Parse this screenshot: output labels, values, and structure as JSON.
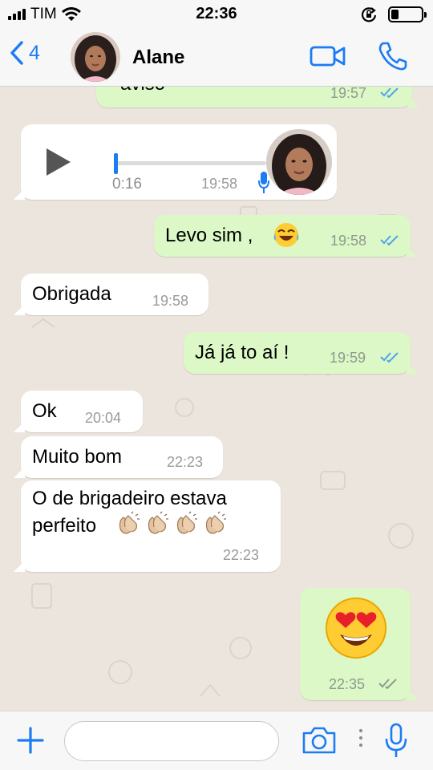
{
  "status_bar": {
    "carrier": "TIM",
    "time": "22:36",
    "battery_level": 0.25
  },
  "header": {
    "back_count": "4",
    "contact_name": "Alane"
  },
  "colors": {
    "accent": "#1c7cf4",
    "outgoing_bubble": "#dcf8c6",
    "incoming_bubble": "#ffffff",
    "chat_background": "#ece5dd",
    "read_ticks": "#4fa5e8",
    "delivered_ticks": "#8e9a8e"
  },
  "messages": [
    {
      "direction": "outgoing",
      "text": "aviso",
      "time": "19:57",
      "status": "read"
    },
    {
      "direction": "incoming",
      "type": "voice",
      "duration": "0:16",
      "time": "19:58",
      "progress": 0
    },
    {
      "direction": "outgoing",
      "text": "Levo sim ,",
      "emoji": "face-with-tears-of-joy",
      "time": "19:58",
      "status": "read"
    },
    {
      "direction": "incoming",
      "text": "Obrigada",
      "time": "19:58"
    },
    {
      "direction": "outgoing",
      "text": "Já já to aí !",
      "time": "19:59",
      "status": "read"
    },
    {
      "direction": "incoming",
      "text": "Ok",
      "time": "20:04"
    },
    {
      "direction": "incoming",
      "text": "Muito bom",
      "time": "22:23"
    },
    {
      "direction": "incoming",
      "lines": [
        "O de brigadeiro estava",
        "perfeito"
      ],
      "emoji": "clapping-hands x4",
      "time": "22:23"
    },
    {
      "direction": "outgoing",
      "emoji": "smiling-face-with-heart-eyes",
      "time": "22:35",
      "status": "delivered"
    }
  ],
  "input_bar": {
    "placeholder": ""
  },
  "icons": [
    "signal-bars-icon",
    "wifi-icon",
    "rotation-lock-icon",
    "battery-icon",
    "back-chevron-icon",
    "video-call-icon",
    "phone-icon",
    "play-icon",
    "microphone-icon",
    "double-check-icon",
    "plus-icon",
    "camera-icon",
    "more-dots-icon"
  ]
}
